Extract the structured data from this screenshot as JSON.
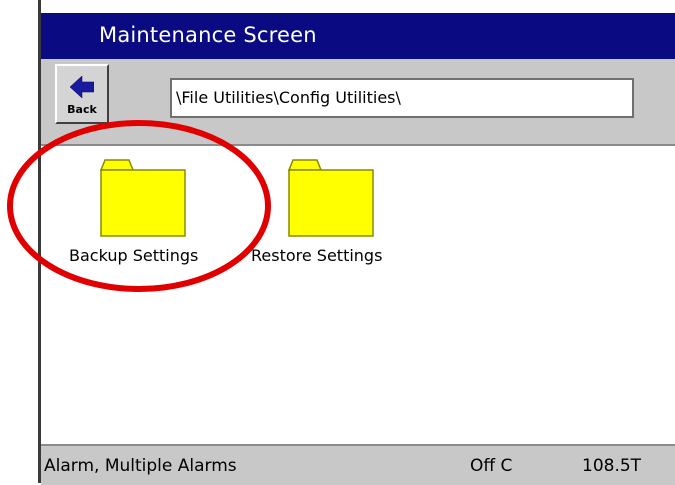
{
  "window": {
    "title": "Maintenance Screen"
  },
  "toolbar": {
    "back_label": "Back",
    "path_value": "\\File Utilities\\Config Utilities\\"
  },
  "folders": [
    {
      "label": "Backup Settings",
      "icon": "folder-icon"
    },
    {
      "label": "Restore Settings",
      "icon": "folder-icon"
    }
  ],
  "status_bar": {
    "alarm_text": "Alarm, Multiple Alarms",
    "mode_text": "Off C",
    "value_text": "108.5T"
  },
  "colors": {
    "title_bar": "#0a0a82",
    "folder_fill": "#ffff00",
    "highlight_ellipse": "#e00000"
  }
}
